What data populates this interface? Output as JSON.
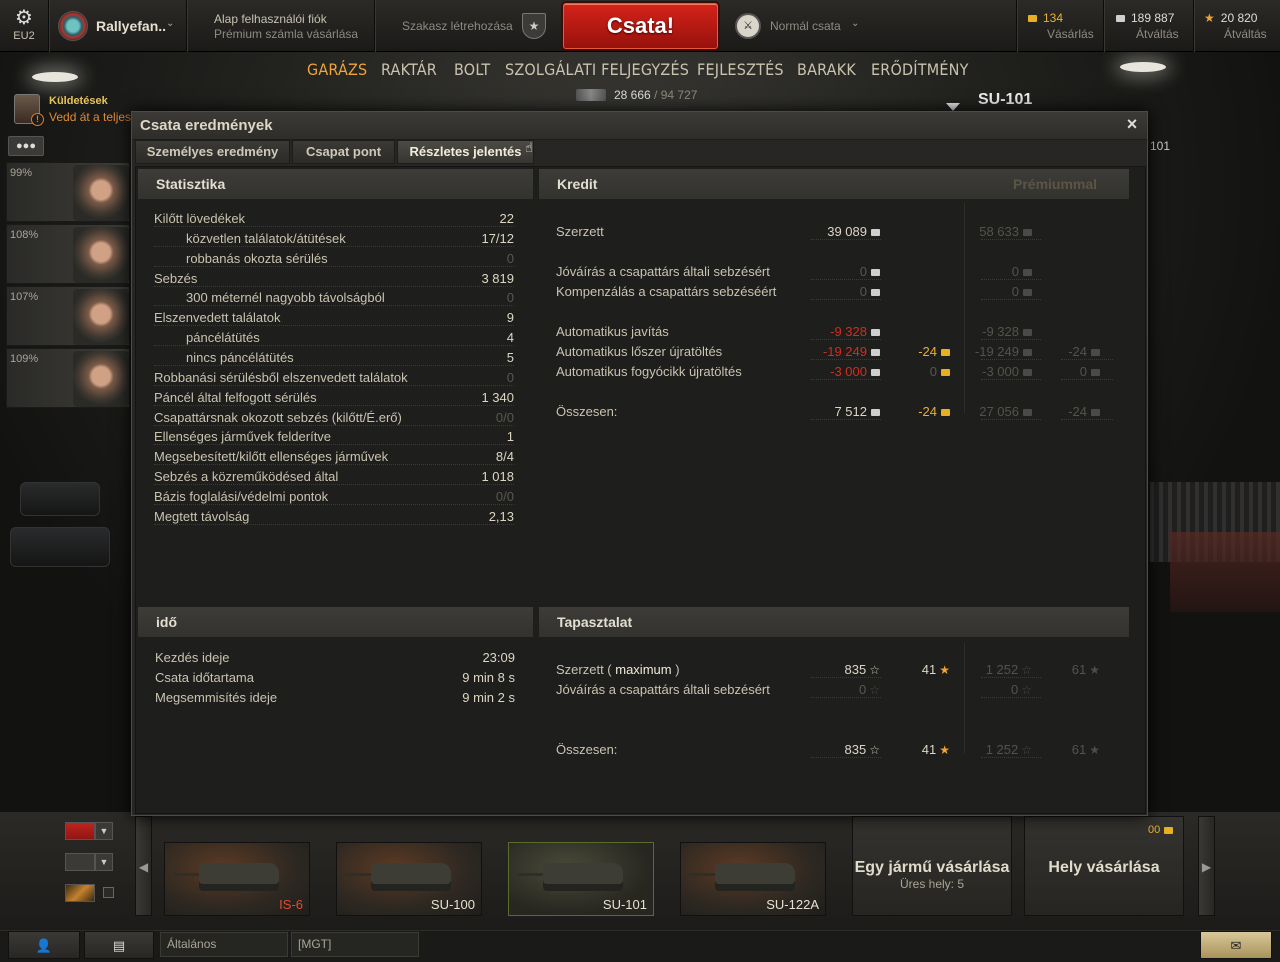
{
  "topbar": {
    "server": "EU2",
    "username": "Rallyefan..",
    "account_line1": "Alap felhasználói fiók",
    "account_line2": "Prémium számla vásárlása",
    "platoon": "Szakasz létrehozása",
    "battle_button": "Csata!",
    "battle_mode": "Normál csata",
    "gold": {
      "value": "134",
      "action": "Vásárlás"
    },
    "credits": {
      "value": "189 887",
      "action": "Átváltás"
    },
    "free_xp": {
      "value": "20 820",
      "action": "Átváltás"
    }
  },
  "nav": {
    "items": [
      "GARÁZS",
      "RAKTÁR",
      "BOLT",
      "SZOLGÁLATI FELJEGYZÉS",
      "FEJLESZTÉS",
      "BARAKK",
      "ERŐDÍTMÉNY"
    ],
    "active": "GARÁZS",
    "xp_current": "28 666",
    "xp_total": "/ 94 727"
  },
  "vehicle_name": "SU-101",
  "vehicle_name_small": "101",
  "missions": {
    "title": "Küldetések",
    "text": "Vedd át a teljes"
  },
  "crew": [
    "99%",
    "108%",
    "107%",
    "109%"
  ],
  "dialog": {
    "title": "Csata eredmények",
    "tabs": [
      "Személyes eredmény",
      "Csapat pont",
      "Részletes jelentés"
    ],
    "stats": {
      "header": "Statisztika",
      "rows": [
        {
          "label": "Kilőtt lövedékek",
          "value": "22"
        },
        {
          "label": "közvetlen találatok/átütések",
          "value": "17/12"
        },
        {
          "label": "robbanás okozta sérülés",
          "value": "0"
        },
        {
          "label": "Sebzés",
          "value": "3 819"
        },
        {
          "label": "300 méternél nagyobb távolságból",
          "value": "0"
        },
        {
          "label": "Elszenvedett találatok",
          "value": "9"
        },
        {
          "label": "páncélátütés",
          "value": "4"
        },
        {
          "label": "nincs páncélátütés",
          "value": "5"
        },
        {
          "label": "Robbanási sérülésből elszenvedett találatok",
          "value": "0"
        },
        {
          "label": "Páncél által felfogott sérülés",
          "value": "1 340"
        },
        {
          "label": "Csapattársnak okozott sebzés (kilőtt/É.erő)",
          "value": "0/0"
        },
        {
          "label": "Ellenséges járművek felderítve",
          "value": "1"
        },
        {
          "label": "Megsebesített/kilőtt ellenséges járművek",
          "value": "8/4"
        },
        {
          "label": "Sebzés a közreműködésed által",
          "value": "1 018"
        },
        {
          "label": "Bázis foglalási/védelmi pontok",
          "value": "0/0"
        },
        {
          "label": "Megtett távolság",
          "value": "2,13"
        }
      ]
    },
    "credits": {
      "header": "Kredit",
      "premium_header": "Prémiummal",
      "rows": [
        {
          "label": "Szerzett",
          "credits": "39 089",
          "gold": "",
          "prem_credits": "58 633",
          "prem_gold": ""
        },
        {
          "label": "Jóváírás a csapattárs általi sebzésért",
          "credits": "0",
          "gold": "",
          "prem_credits": "0",
          "prem_gold": ""
        },
        {
          "label": "Kompenzálás a csapattárs sebzéséért",
          "credits": "0",
          "gold": "",
          "prem_credits": "0",
          "prem_gold": ""
        },
        {
          "label": "Automatikus javítás",
          "credits": "-9 328",
          "gold": "",
          "prem_credits": "-9 328",
          "prem_gold": ""
        },
        {
          "label": "Automatikus lőszer újratöltés",
          "credits": "-19 249",
          "gold": "-24",
          "prem_credits": "-19 249",
          "prem_gold": "-24"
        },
        {
          "label": "Automatikus fogyócikk újratöltés",
          "credits": "-3 000",
          "gold": "0",
          "prem_credits": "-3 000",
          "prem_gold": "0"
        },
        {
          "label": "Összesen:",
          "credits": "7 512",
          "gold": "-24",
          "prem_credits": "27 056",
          "prem_gold": "-24"
        }
      ]
    },
    "time": {
      "header": "idő",
      "rows": [
        {
          "label": "Kezdés ideje",
          "value": "23:09"
        },
        {
          "label": "Csata időtartama",
          "value": "9 min 8 s"
        },
        {
          "label": "Megsemmisítés ideje",
          "value": "9 min 2 s"
        }
      ]
    },
    "xp": {
      "header": "Tapasztalat",
      "earned_label": "Szerzett (",
      "earned_max": "maximum",
      "earned_close": ")",
      "rows": [
        {
          "label": "Szerzett",
          "xp": "835",
          "free": "41",
          "prem_xp": "1 252",
          "prem_free": "61"
        },
        {
          "label": "Jóváírás a csapattárs általi sebzésért",
          "xp": "0",
          "free": "",
          "prem_xp": "0",
          "prem_free": ""
        },
        {
          "label": "Összesen:",
          "xp": "835",
          "free": "41",
          "prem_xp": "1 252",
          "prem_free": "61"
        }
      ]
    }
  },
  "carousel": {
    "tanks": [
      "IS-6",
      "SU-100",
      "SU-101",
      "SU-122A"
    ],
    "buy_vehicle": {
      "title": "Egy jármű vásárlása",
      "sub": "Üres hely: 5"
    },
    "buy_slot": {
      "title": "Hely vásárlása"
    },
    "slot_price": "00"
  },
  "chat": {
    "tab1": "Általános",
    "tab2": "[MGT]"
  },
  "colors": {
    "accent": "#f0a43a",
    "battle": "#c41d16",
    "negative": "#d42c1f",
    "gold": "#e9b032"
  }
}
